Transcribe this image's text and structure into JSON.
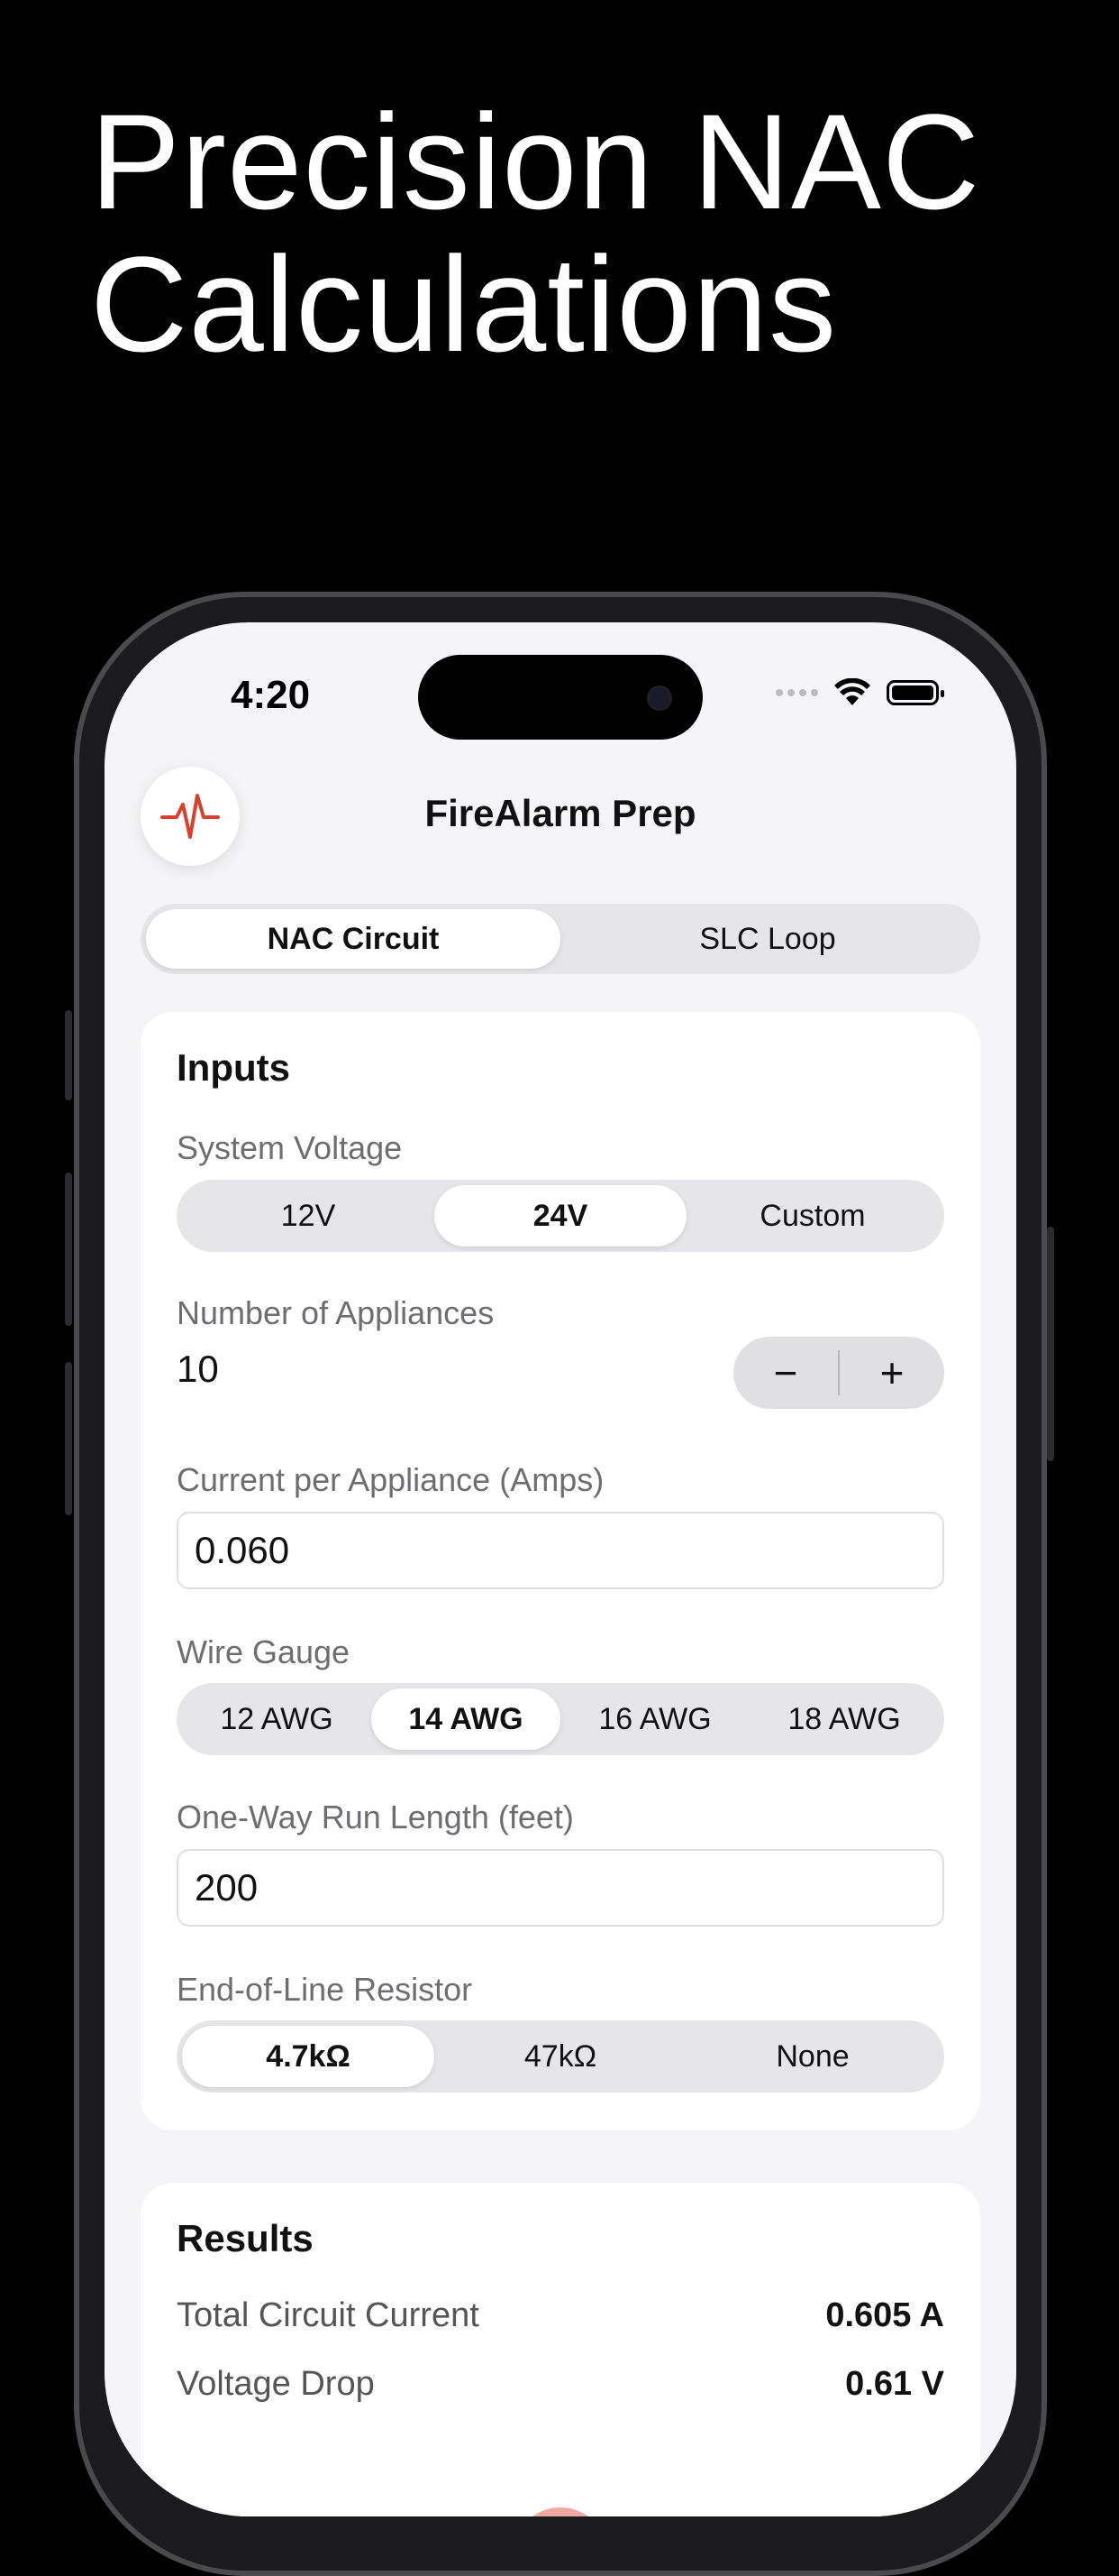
{
  "promo": {
    "headline_line1": "Precision NAC",
    "headline_line2": "Calculations"
  },
  "status_bar": {
    "time": "4:20"
  },
  "app": {
    "title": "FireAlarm Prep",
    "logo_icon": "heartbeat-pulse-icon",
    "accent_color": "#d9412f"
  },
  "mode_tabs": {
    "items": [
      "NAC Circuit",
      "SLC Loop"
    ],
    "selected": "NAC Circuit"
  },
  "inputs": {
    "heading": "Inputs",
    "system_voltage": {
      "label": "System Voltage",
      "options": [
        "12V",
        "24V",
        "Custom"
      ],
      "selected": "24V"
    },
    "appliances": {
      "label": "Number of Appliances",
      "value": "10",
      "minus": "−",
      "plus": "+"
    },
    "current": {
      "label": "Current per Appliance (Amps)",
      "value": "0.060"
    },
    "wire_gauge": {
      "label": "Wire Gauge",
      "options": [
        "12 AWG",
        "14 AWG",
        "16 AWG",
        "18 AWG"
      ],
      "selected": "14 AWG"
    },
    "run_length": {
      "label": "One-Way Run Length (feet)",
      "value": "200"
    },
    "eol_resistor": {
      "label": "End-of-Line Resistor",
      "options": [
        "4.7kΩ",
        "47kΩ",
        "None"
      ],
      "selected": "4.7kΩ"
    }
  },
  "results": {
    "heading": "Results",
    "rows": [
      {
        "label": "Total Circuit Current",
        "value": "0.605 A"
      },
      {
        "label": "Voltage Drop",
        "value": "0.61 V"
      }
    ]
  }
}
